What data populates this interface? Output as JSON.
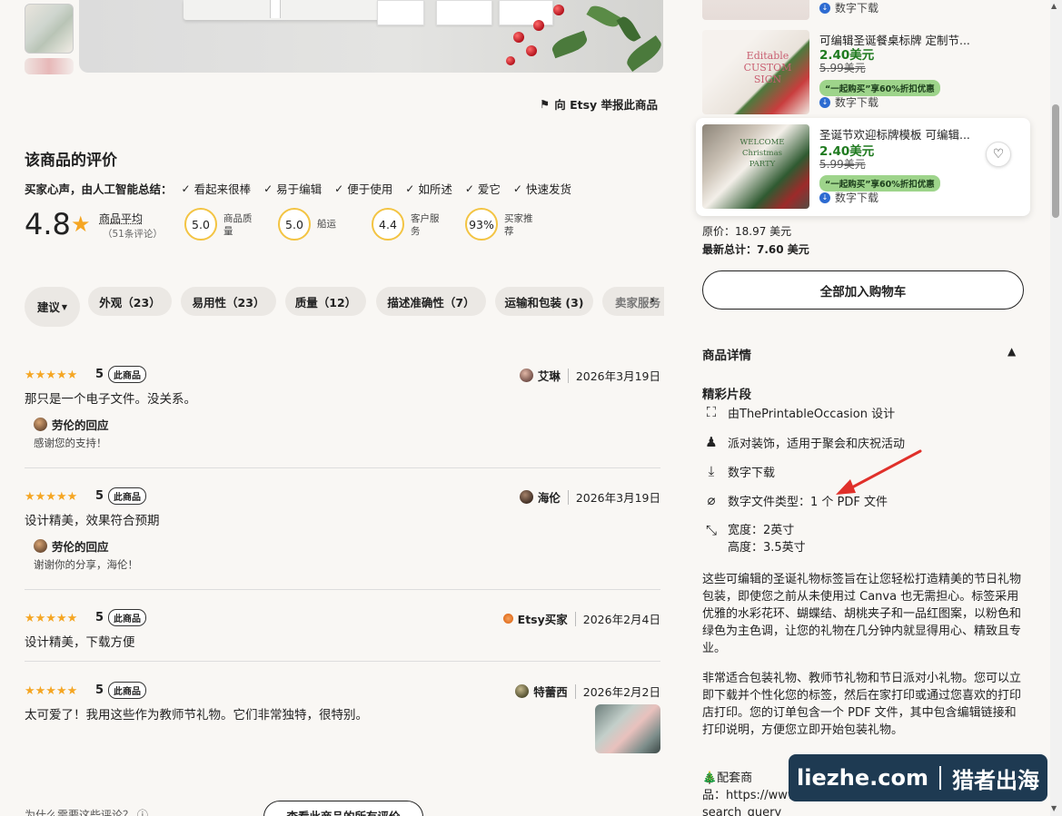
{
  "report_link": "向 Etsy 举报此商品",
  "reviews_section": {
    "title": "该商品的评价",
    "ai_label": "买家心声，由人工智能总结：",
    "ai_tags": [
      "看起来很棒",
      "易于编辑",
      "便于使用",
      "如所述",
      "爱它",
      "快速发货"
    ],
    "rating": "4.8",
    "avg_label": "商品平均",
    "avg_count": "（51条评论）",
    "metrics": [
      {
        "value": "5.0",
        "label": "商品质量"
      },
      {
        "value": "5.0",
        "label": "船运"
      },
      {
        "value": "4.4",
        "label": "客户服务"
      },
      {
        "value": "93%",
        "label": "买家推荐"
      }
    ],
    "sort_label": "建议",
    "filters": [
      "外观（23）",
      "易用性（23）",
      "质量（12）",
      "描述准确性（7）",
      "运输和包装 (3)",
      "卖家服务"
    ],
    "reviews": [
      {
        "stars": "★★★★★",
        "score": "5",
        "badge": "此商品",
        "text": "那只是一个电子文件。没关系。",
        "author": "艾琳",
        "date": "2026年3月19日",
        "reply_title": "劳伦的回应",
        "reply_text": "感谢您的支持！"
      },
      {
        "stars": "★★★★★",
        "score": "5",
        "badge": "此商品",
        "text": "设计精美，效果符合预期",
        "author": "海伦",
        "date": "2026年3月19日",
        "reply_title": "劳伦的回应",
        "reply_text": "谢谢你的分享，海伦！"
      },
      {
        "stars": "★★★★★",
        "score": "5",
        "badge": "此商品",
        "text": "设计精美，下载方便",
        "author": "Etsy买家",
        "date": "2026年2月4日"
      },
      {
        "stars": "★★★★★",
        "score": "5",
        "badge": "此商品",
        "text": "太可爱了！我用这些作为教师节礼物。它们非常独特，很特别。",
        "author": "特蕾西",
        "date": "2026年2月2日"
      }
    ],
    "why_label": "为什么需要这些评论？",
    "see_all": "查看此商品的所有评价"
  },
  "recommendations": [
    {
      "download": "数字下载"
    },
    {
      "name": "可编辑圣诞餐桌标牌 定制节...",
      "price": "2.40美元",
      "orig": "5.99美元",
      "promo": "“一起购买”享60%折扣优惠",
      "download": "数字下载",
      "img_text": "Editable CUSTOM SIGN"
    },
    {
      "name": "圣诞节欢迎标牌模板 可编辑...",
      "price": "2.40美元",
      "orig": "5.99美元",
      "promo": "“一起购买”享60%折扣优惠",
      "download": "数字下载",
      "img_text": "WELCOME Christmas PARTY"
    }
  ],
  "bundle": {
    "original_price": "原价：18.97 美元",
    "new_total": "最新总计：7.60 美元",
    "add_all": "全部加入购物车"
  },
  "details": {
    "title": "商品详情",
    "highlights_title": "精彩片段",
    "features": [
      {
        "icon": "designer-icon",
        "text": "由ThePrintableOccasion 设计"
      },
      {
        "icon": "party-icon",
        "text": "派对装饰，适用于聚会和庆祝活动"
      },
      {
        "icon": "download-icon",
        "text": "数字下载"
      },
      {
        "icon": "paperclip-icon",
        "text": "数字文件类型：1 个 PDF 文件"
      },
      {
        "icon": "dimensions-icon",
        "text": "宽度：2英寸",
        "text2": "高度：3.5英寸"
      }
    ],
    "description_1": "这些可编辑的圣诞礼物标签旨在让您轻松打造精美的节日礼物包装，即使您之前从未使用过 Canva 也无需担心。标签采用优雅的水彩花环、蝴蝶结、胡桃夹子和一品红图案，以粉色和绿色为主色调，让您的礼物在几分钟内就显得用心、精致且专业。",
    "description_2": "非常适合包装礼物、教师节礼物和节日派对小礼物。您可以立即下载并个性化您的标签，然后在家打印或通过您喜欢的打印店打印。您的订单包含一个 PDF 文件，其中包含编辑链接和打印说明，方便您立即开始包装礼物。",
    "match_prefix": "🎄配套商",
    "match_label": "品：",
    "match_link": "https://www.etsy.com/shop/ThePrintableOccasion?",
    "match_link2": "search_query"
  },
  "watermark": {
    "left": "liezhe.com",
    "right": "猎者出海"
  },
  "colors": {
    "star": "#f5a623",
    "price_green": "#1f7a1f",
    "promo_green": "#9ed48b",
    "arrow_red": "#e0302a"
  }
}
